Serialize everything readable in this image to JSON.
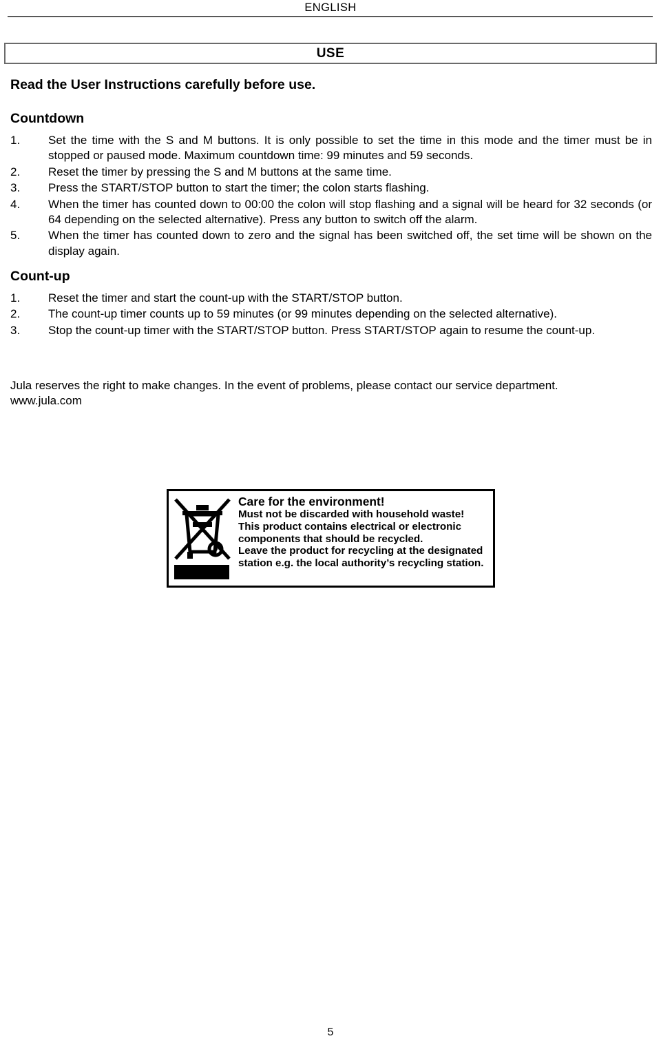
{
  "header": {
    "language": "ENGLISH"
  },
  "title_box": {
    "title": "USE"
  },
  "lead": "Read the User Instructions carefully before use.",
  "countdown": {
    "heading": "Countdown",
    "steps": [
      {
        "num": "1.",
        "text": "Set the time with the S and M buttons. It is only possible to set the time in this mode and the timer must be in stopped or paused mode. Maximum countdown time: 99 minutes and 59 seconds."
      },
      {
        "num": "2.",
        "text": "Reset the timer by pressing the S and M buttons at the same time."
      },
      {
        "num": "3.",
        "text": "Press the START/STOP button to start the timer; the colon starts flashing."
      },
      {
        "num": "4.",
        "text": "When the timer has counted down to 00:00 the colon will stop flashing and a signal will be heard for 32 seconds (or 64 depending on the selected alternative). Press any button to switch off the alarm."
      },
      {
        "num": "5.",
        "text": "When the timer has counted down to zero and the signal has been switched off, the set time will be shown on the display again."
      }
    ]
  },
  "countup": {
    "heading": "Count-up",
    "steps": [
      {
        "num": "1.",
        "text": "Reset the timer and start the count-up with the START/STOP button."
      },
      {
        "num": "2.",
        "text": "The count-up timer counts up to 59 minutes (or 99 minutes depending on the selected alternative)."
      },
      {
        "num": "3.",
        "text": "Stop the count-up timer with the START/STOP button. Press START/STOP again to resume the count-up."
      }
    ]
  },
  "closing": {
    "paragraph": "Jula reserves the right to make changes. In the event of problems, please contact our service department.",
    "url": "www.jula.com"
  },
  "weee": {
    "icon_name": "crossed-out-wheeled-bin-icon",
    "headline": "Care for the environment!",
    "lines": [
      "Must not be discarded with household waste!",
      "This product contains electrical or electronic",
      "components that should be recycled.",
      "Leave the product for recycling at the designated",
      "station e.g. the local authority’s recycling station."
    ]
  },
  "footer": {
    "page_number": "5"
  },
  "colors": {
    "text": "#000000",
    "rule": "#595959",
    "box_border": "#6b6b6b",
    "weee_border": "#000000",
    "background": "#ffffff"
  }
}
